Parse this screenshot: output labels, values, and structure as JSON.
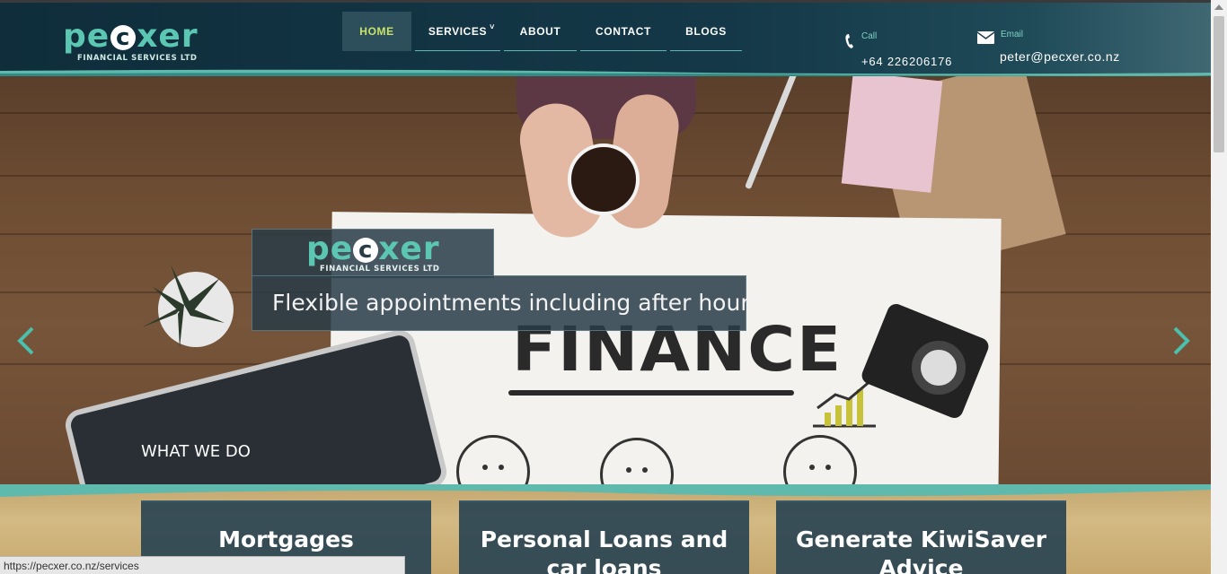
{
  "brand": {
    "name": "pecxer",
    "name_start": "pe",
    "name_c": "c",
    "name_end": "xer",
    "subtitle": "FINANCIAL SERVICES LTD"
  },
  "nav": {
    "items": [
      {
        "label": "HOME",
        "active": true
      },
      {
        "label": "SERVICES",
        "has_dropdown": true
      },
      {
        "label": "ABOUT"
      },
      {
        "label": "CONTACT"
      },
      {
        "label": "BLOGS"
      }
    ],
    "dropdown_glyph": "˅"
  },
  "contact": {
    "call_label": "Call",
    "call_value": "+64 226206176",
    "email_label": "Email",
    "email_value": "peter@pecxer.co.nz",
    "phone_icon": "phone-icon",
    "email_icon": "mail-icon"
  },
  "hero": {
    "tagline": "Flexible appointments including after hours",
    "background_word": "FINANCE",
    "section_heading": "WHAT WE DO"
  },
  "services": {
    "cards": [
      {
        "title": "Mortgages"
      },
      {
        "title": "Personal Loans and car loans"
      },
      {
        "title": "Generate KiwiSaver Advice"
      }
    ]
  },
  "status_bar": {
    "url": "https://pecxer.co.nz/services"
  },
  "colors": {
    "accent": "#5bc6b1",
    "header_bg": "#0f2d3b",
    "active_nav_text": "#c9e26a",
    "card_bg": "#2a4452"
  }
}
